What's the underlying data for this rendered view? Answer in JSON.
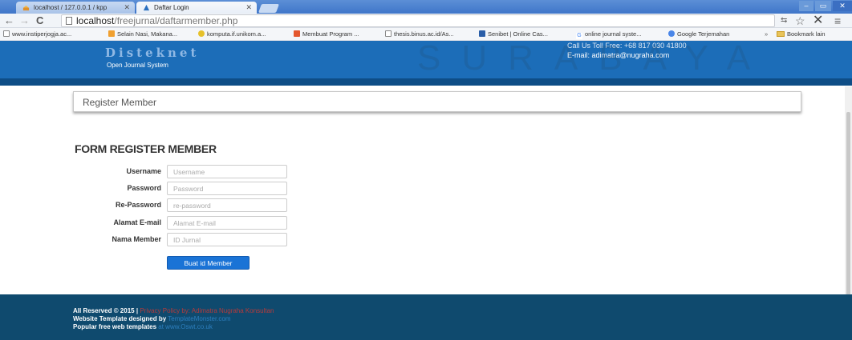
{
  "browser": {
    "tabs": [
      {
        "title": "localhost / 127.0.0.1 / kpp",
        "active": false
      },
      {
        "title": "Daftar Login",
        "active": true
      }
    ],
    "url_host": "localhost",
    "url_path": "/freejurnal/daftarmember.php",
    "bookmarks": [
      "www.instiperjogja.ac...",
      "Selain Nasi, Makana...",
      "komputa.if.unikom.a...",
      "Membuat Program ...",
      "thesis.binus.ac.id/As...",
      "Senibet | Online Cas...",
      "online journal syste...",
      "Google Terjemahan"
    ],
    "bookmarks_more": "»",
    "other_bookmarks": "Bookmark lain"
  },
  "site": {
    "logo": "Disteknet",
    "tagline": "Open Journal System",
    "contact_phone": "Call Us Toll Free: +68 817 030 41800",
    "contact_email": "E-mail: adimatra@nugraha.com",
    "watermark": "SURABAYA"
  },
  "page": {
    "breadcrumb": "Register Member",
    "form_title": "FORM REGISTER MEMBER",
    "fields": [
      {
        "label": "Username",
        "placeholder": "Username",
        "value": ""
      },
      {
        "label": "Password",
        "placeholder": "Password",
        "value": ""
      },
      {
        "label": "Re-Password",
        "placeholder": "re-password",
        "value": ""
      },
      {
        "label": "Alamat E-mail",
        "placeholder": "Alamat E-mail",
        "value": ""
      },
      {
        "label": "Nama Member",
        "placeholder": "ID Jurnal",
        "value": ""
      }
    ],
    "submit_label": "Buat id Member"
  },
  "footer": {
    "line1_text": "All Reserved © 2015 |",
    "line1_link": "Privacy Policy by: Adimatra Nugraha Konsultan",
    "line2_text": "Website Template designed by",
    "line2_link": "TemplateMonster.com",
    "line3_text": "Popular free web templates",
    "line3_link": "at www.Oswt.co.uk"
  },
  "colors": {
    "header_blue": "#1c6db8",
    "footer_navy": "#0f4a6e",
    "button_blue": "#1a73d6",
    "footer_link_red": "#b83a3a"
  }
}
